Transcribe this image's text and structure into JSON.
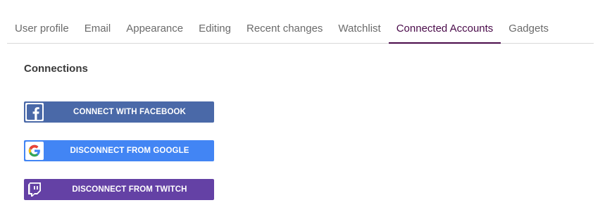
{
  "tabs": [
    {
      "label": "User profile",
      "active": false
    },
    {
      "label": "Email",
      "active": false
    },
    {
      "label": "Appearance",
      "active": false
    },
    {
      "label": "Editing",
      "active": false
    },
    {
      "label": "Recent changes",
      "active": false
    },
    {
      "label": "Watchlist",
      "active": false
    },
    {
      "label": "Connected Accounts",
      "active": true
    },
    {
      "label": "Gadgets",
      "active": false
    }
  ],
  "connections": {
    "heading": "Connections",
    "buttons": [
      {
        "label": "CONNECT WITH FACEBOOK",
        "icon": "facebook-icon",
        "color": "#4a69a8"
      },
      {
        "label": "DISCONNECT FROM GOOGLE",
        "icon": "google-icon",
        "color": "#4285f4"
      },
      {
        "label": "DISCONNECT FROM TWITCH",
        "icon": "twitch-icon",
        "color": "#6441a5"
      }
    ]
  },
  "colors": {
    "active_tab": "#4a0b4a",
    "tab_text": "#6b6b6b"
  }
}
